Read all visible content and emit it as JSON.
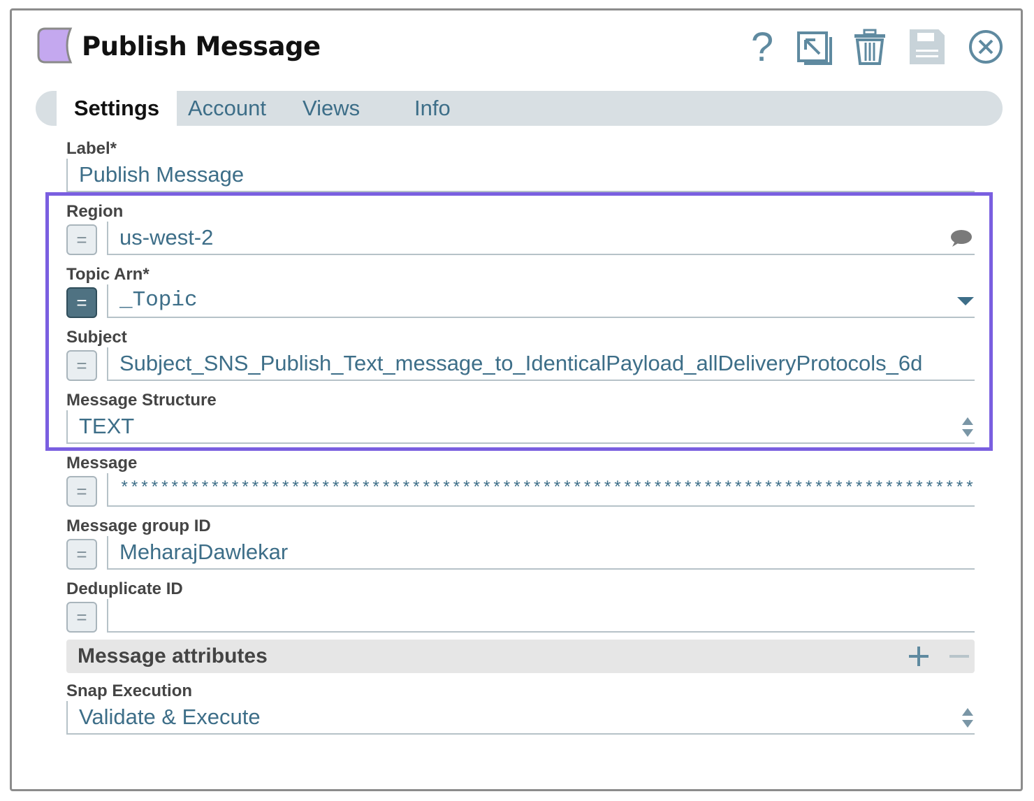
{
  "dialog": {
    "title": "Publish Message",
    "header_icons": [
      "help-icon",
      "export-icon",
      "trash-icon",
      "save-icon",
      "close-icon"
    ],
    "help_glyph": "?"
  },
  "tabs": [
    {
      "label": "Settings",
      "active": true
    },
    {
      "label": "Account"
    },
    {
      "label": "Views"
    },
    {
      "label": "Info"
    }
  ],
  "fields": {
    "label": {
      "label": "Label*",
      "value": "Publish Message"
    },
    "region": {
      "label": "Region",
      "value": "us-west-2",
      "eq": "="
    },
    "topic_arn": {
      "label": "Topic Arn*",
      "value": "_Topic",
      "eq": "="
    },
    "subject": {
      "label": "Subject",
      "value": "Subject_SNS_Publish_Text_message_to_IdenticalPayload_allDeliveryProtocols_6d",
      "eq": "="
    },
    "message_structure": {
      "label": "Message Structure",
      "value": "TEXT"
    },
    "message": {
      "label": "Message",
      "value": "**********************************************************************************************",
      "eq": "="
    },
    "message_group_id": {
      "label": "Message group ID",
      "value": "MeharajDawlekar",
      "eq": "="
    },
    "deduplicate_id": {
      "label": "Deduplicate ID",
      "value": "",
      "eq": "="
    },
    "message_attributes": {
      "label": "Message attributes"
    },
    "snap_execution": {
      "label": "Snap Execution",
      "value": "Validate & Execute"
    }
  },
  "colors": {
    "accent": "#3d6e88",
    "highlight_border": "#7a5fe0",
    "snap_icon": "#c4a8ef"
  }
}
